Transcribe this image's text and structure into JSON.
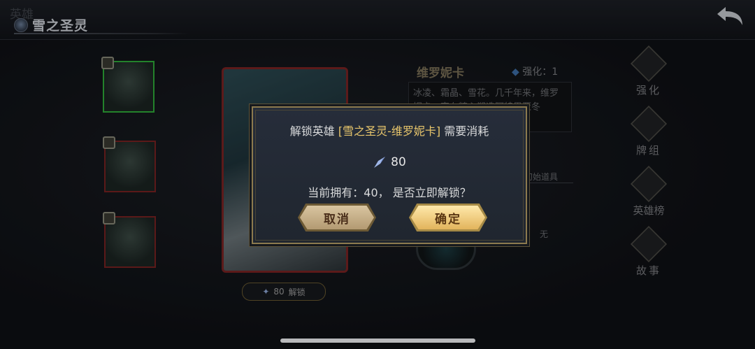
{
  "header": {
    "bg_title": "英雄",
    "title": "雪之圣灵"
  },
  "hero": {
    "name": "维罗妮卡",
    "enhance_label": "强化：1",
    "description": "冰凌、霜晶、雪花。几千年来，维罗妮卡一直在精心塑造阿特里亚冬",
    "init_items_label": "初始道具",
    "init_items_value": "无",
    "unlock_cost": "80",
    "unlock_label": "解锁"
  },
  "side_menu": [
    {
      "label": "强化",
      "icon": "enhance-icon"
    },
    {
      "label": "牌组",
      "icon": "deck-icon"
    },
    {
      "label": "英雄榜",
      "icon": "hero-ranking-icon"
    },
    {
      "label": "故事",
      "icon": "story-icon"
    }
  ],
  "dialog": {
    "prefix": "解锁英雄",
    "hero_full": "[雪之圣灵-维罗妮卡]",
    "suffix": "需要消耗",
    "cost": "80",
    "owned_text": "当前拥有：40， 是否立即解锁？",
    "cancel": "取消",
    "confirm": "确定"
  },
  "colors": {
    "highlight": "#e8c66c",
    "frame_gold": "#8c7a4e",
    "dialog_bg": "#262d3a"
  }
}
